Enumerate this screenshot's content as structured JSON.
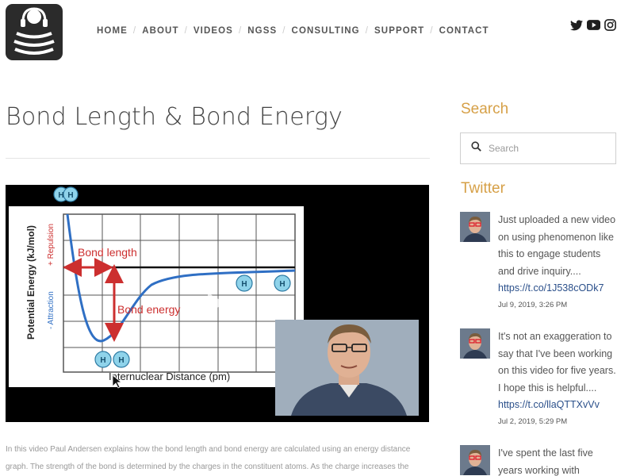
{
  "nav": {
    "items": [
      "HOME",
      "ABOUT",
      "VIDEOS",
      "NGSS",
      "CONSULTING",
      "SUPPORT",
      "CONTACT"
    ],
    "separator": "/"
  },
  "social": {
    "icons": [
      "twitter-icon",
      "youtube-icon",
      "instagram-icon"
    ]
  },
  "article": {
    "title": "Bond Length & Bond Energy",
    "description": "In this video Paul Andersen explains how the bond length and bond energy are calculated using an energy distance graph. The strength of the bond is determined by the charges in the constituent atoms. As the charge increases the"
  },
  "video": {
    "ylabel": "Potential Energy (kJ/mol)",
    "xlabel": "Internuclear Distance (pm)",
    "repulsion": "+ Repulsion",
    "attraction": "- Attraction",
    "bond_length": "Bond length",
    "bond_energy": "Bond energy",
    "atom": "H"
  },
  "sidebar": {
    "search_heading": "Search",
    "search_placeholder": "Search",
    "twitter_heading": "Twitter",
    "tweets": [
      {
        "text": "Just uploaded a new video on using phenomenon like this to engage students and drive inquiry....",
        "link": "https://t.co/1J538cODk7",
        "date": "Jul 9, 2019, 3:26 PM"
      },
      {
        "text": "It's not an exaggeration to say that I've been working on this video for five years. I hope this is helpful....",
        "link": "https://t.co/llaQTTXvVv",
        "date": "Jul 2, 2019, 5:29 PM"
      },
      {
        "text": "I've spent the last five years working with",
        "link": "",
        "date": ""
      }
    ]
  },
  "colors": {
    "accent": "#d6a047",
    "link": "#2a4f8a",
    "curve": "#2f6fc4",
    "arrow": "#cc2f2f"
  }
}
